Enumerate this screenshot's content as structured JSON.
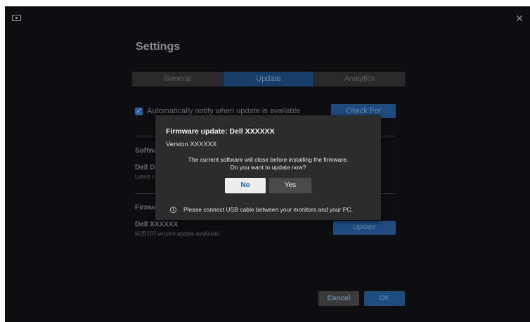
{
  "window": {
    "close_glyph": "✕"
  },
  "settings": {
    "title": "Settings",
    "tabs": [
      {
        "label": "General"
      },
      {
        "label": "Update"
      },
      {
        "label": "Analytics"
      }
    ],
    "auto_notify_label": "Automatically notify when update is available",
    "auto_notify_checked": true,
    "check_updates_label": "Check For Updates",
    "software_section_label": "Softwa",
    "software_item_title": "Dell Di",
    "software_item_sub": "Latest s",
    "firmware_section_label": "Firmw",
    "firmware_item_title": "Dell XXXXXX",
    "firmware_item_sub": "M2B107 version update available!",
    "update_button_label": "Update",
    "cancel_label": "Cancel",
    "ok_label": "OK"
  },
  "dialog": {
    "title": "Firmware update: Dell XXXXXX",
    "version": "Version XXXXXX",
    "message_line1": "The current software will close before installing the firmware.",
    "message_line2": "Do you want to update now?",
    "no_label": "No",
    "yes_label": "Yes",
    "note": "Please connect USB cable between your monitors and your PC.",
    "info_glyph": "i"
  },
  "colors": {
    "background": "#0e0e10",
    "accent": "#1e4c80",
    "dialog_bg": "#2c2c2d",
    "no_button_text": "#1f5fa6"
  }
}
